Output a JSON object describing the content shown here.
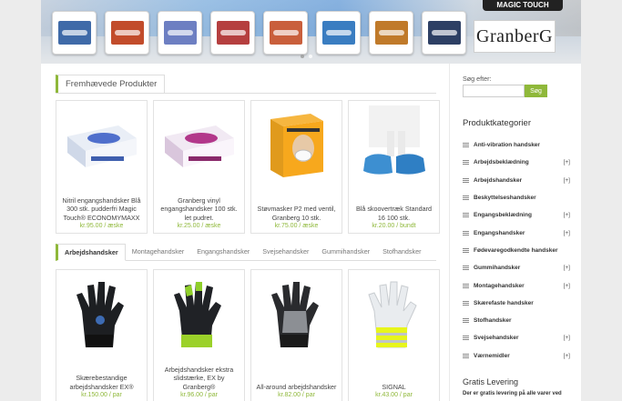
{
  "banner": {
    "badge": "MAGIC TOUCH",
    "logo": "GranberG",
    "thumbs": [
      {
        "color": "#3f6aa8"
      },
      {
        "color": "#c24c2b"
      },
      {
        "color": "#6d7fc2"
      },
      {
        "color": "#b53f3f"
      },
      {
        "color": "#c95f3c"
      },
      {
        "color": "#3a7dc1"
      },
      {
        "color": "#c07a2a"
      },
      {
        "color": "#2d3f64"
      }
    ]
  },
  "featured": {
    "title": "Fremhævede Produkter",
    "products": [
      {
        "name": "Nitril engangshandsker Blå 300 stk. pudderfri Magic Touch® ECONOMYMAXX",
        "price": "kr.95.00 / æske",
        "img": "box-blue"
      },
      {
        "name": "Granberg vinyl engangshandsker 100 stk. let pudret.",
        "price": "kr.25.00 / æske",
        "img": "box-pink"
      },
      {
        "name": "Støvmasker P2 med ventil, Granberg 10 stk.",
        "price": "kr.75.00 / æske",
        "img": "box-mask"
      },
      {
        "name": "Blå skoovertræk Standard 16 100 stk.",
        "price": "kr.20.00 / bundt",
        "img": "shoe-covers"
      }
    ]
  },
  "tabs": [
    "Arbejdshandsker",
    "Montagehandsker",
    "Engangshandsker",
    "Svejsehandsker",
    "Gummihandsker",
    "Stofhandsker"
  ],
  "gloves": [
    {
      "name": "Skærebestandige arbejdshandsker EX®",
      "price": "kr.150.00 / par",
      "img": "glove-black"
    },
    {
      "name": "Arbejdshandsker ekstra slidstærke, EX by Granberg®",
      "price": "kr.96.00 / par",
      "img": "glove-green"
    },
    {
      "name": "All-around arbejdshandsker",
      "price": "kr.82.00 / par",
      "img": "glove-grey"
    },
    {
      "name": "SIGNAL",
      "price": "kr.43.00 / par",
      "img": "glove-signal"
    }
  ],
  "sidebar": {
    "search_label": "Søg efter:",
    "search_placeholder": "",
    "search_button": "Søg",
    "categories_title": "Produktkategorier",
    "categories": [
      {
        "label": "Anti-vibration handsker",
        "plus": ""
      },
      {
        "label": "Arbejdsbeklædning",
        "plus": "[+]"
      },
      {
        "label": "Arbejdshandsker",
        "plus": "[+]"
      },
      {
        "label": "Beskyttelseshandsker",
        "plus": ""
      },
      {
        "label": "Engangsbeklædning",
        "plus": "[+]"
      },
      {
        "label": "Engangshandsker",
        "plus": "[+]"
      },
      {
        "label": "Fødevaregodkendte handsker",
        "plus": ""
      },
      {
        "label": "Gummihandsker",
        "plus": "[+]"
      },
      {
        "label": "Montagehandsker",
        "plus": "[+]"
      },
      {
        "label": "Skærefaste handsker",
        "plus": ""
      },
      {
        "label": "Stofhandsker",
        "plus": ""
      },
      {
        "label": "Svejsehandsker",
        "plus": "[+]"
      },
      {
        "label": "Værnemidler",
        "plus": "[+]"
      }
    ],
    "levering_title": "Gratis Levering",
    "levering_text": "Der er gratis levering på alle varer ved"
  },
  "colors": {
    "accent": "#8fb83a"
  }
}
